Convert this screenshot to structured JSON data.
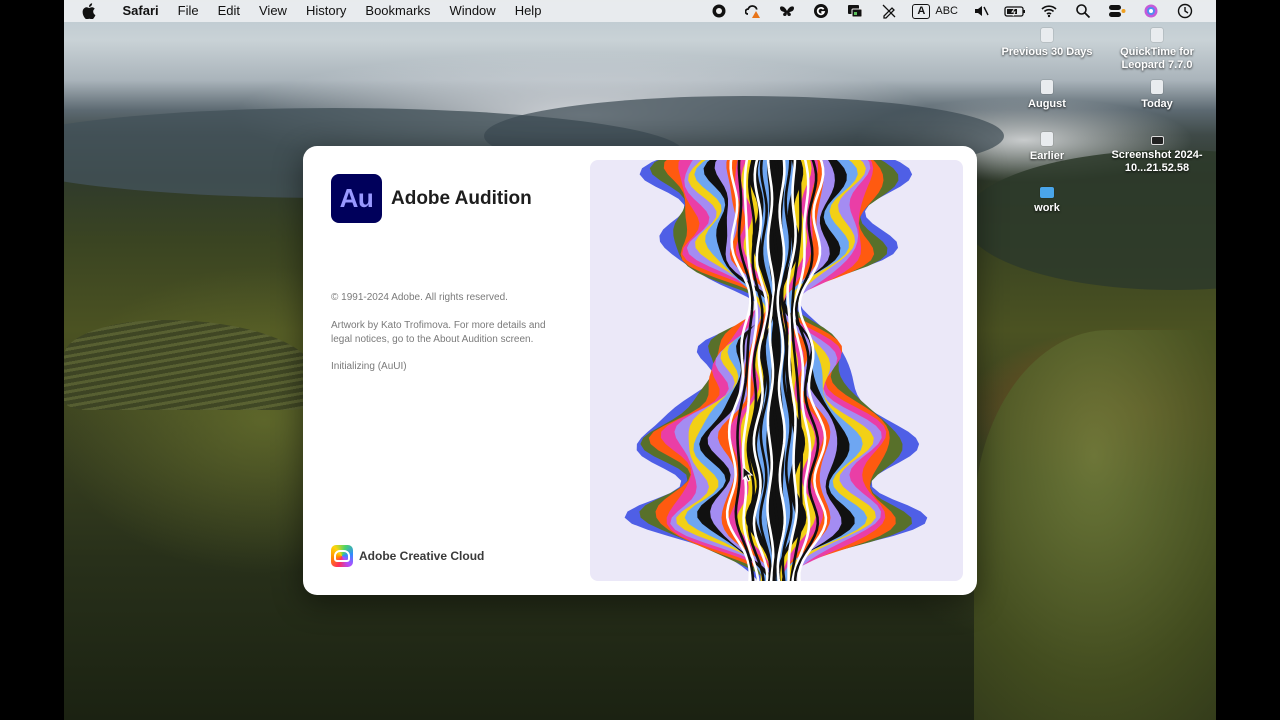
{
  "menubar": {
    "apple_icon": "apple-logo",
    "app_name": "Safari",
    "items": [
      "File",
      "Edit",
      "View",
      "History",
      "Bookmarks",
      "Window",
      "Help"
    ],
    "status_icons": [
      "record-icon",
      "creative-cloud-alert-icon",
      "butterfly-icon",
      "grammarly-icon",
      "network-share-icon",
      "pen-off-icon"
    ],
    "input_source_letter": "A",
    "input_source_label": "ABC",
    "status_icons_right": [
      "mute-icon",
      "battery-icon",
      "wifi-icon",
      "search-icon",
      "control-center-icon",
      "siri-icon",
      "clock-icon"
    ]
  },
  "desktop_icons": [
    {
      "label": "Previous 30 Days"
    },
    {
      "label": "QuickTime for Leopard 7.7.0"
    },
    {
      "label": "August"
    },
    {
      "label": "Today"
    },
    {
      "label": "Earlier"
    },
    {
      "label": "Screenshot 2024-10...21.52.58"
    },
    {
      "label": "work"
    }
  ],
  "splash": {
    "badge": "Au",
    "title": "Adobe Audition",
    "copyright": "© 1991-2024 Adobe. All rights reserved.",
    "artwork_credit": "Artwork by Kato Trofimova. For more details and legal notices, go to the About Audition screen.",
    "status": "Initializing (AuUI)",
    "footer": "Adobe Creative Cloud",
    "badge_bg": "#00005b",
    "badge_fg": "#9999ff"
  },
  "artwork_colors": [
    "#4f5fe6",
    "#58702a",
    "#ff5a10",
    "#ea3ea6",
    "#a48cf2",
    "#f2d016",
    "#6ea6f2",
    "#111111"
  ]
}
